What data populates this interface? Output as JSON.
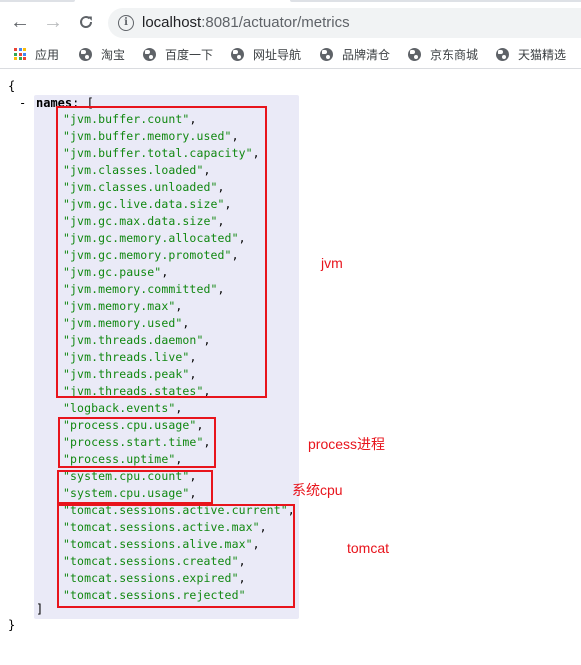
{
  "browser": {
    "url_host": "localhost",
    "url_rest": ":8081/actuator/metrics",
    "nav": {
      "back": "←",
      "forward": "→",
      "reload": "C"
    },
    "info_icon": "i",
    "bookmarks": [
      {
        "label": "应用",
        "icon": "apps-grid-icon"
      },
      {
        "label": "淘宝",
        "icon": "globe-icon"
      },
      {
        "label": "百度一下",
        "icon": "globe-icon"
      },
      {
        "label": "网址导航",
        "icon": "globe-icon"
      },
      {
        "label": "品牌清仓",
        "icon": "globe-icon"
      },
      {
        "label": "京东商城",
        "icon": "globe-icon"
      },
      {
        "label": "天猫精选",
        "icon": "globe-icon"
      }
    ],
    "apps_colors": [
      "#ea4335",
      "#4285f4",
      "#fbbc05",
      "#34a853",
      "#ea4335",
      "#4285f4",
      "#fbbc05",
      "#34a853",
      "#ea4335"
    ]
  },
  "json_view": {
    "open_brace": "{",
    "close_brace": "}",
    "collapse_toggle": "-",
    "key": "names",
    "key_colon": ":",
    "open_bracket": "[",
    "close_bracket": "]",
    "names": [
      "jvm.buffer.count",
      "jvm.buffer.memory.used",
      "jvm.buffer.total.capacity",
      "jvm.classes.loaded",
      "jvm.classes.unloaded",
      "jvm.gc.live.data.size",
      "jvm.gc.max.data.size",
      "jvm.gc.memory.allocated",
      "jvm.gc.memory.promoted",
      "jvm.gc.pause",
      "jvm.memory.committed",
      "jvm.memory.max",
      "jvm.memory.used",
      "jvm.threads.daemon",
      "jvm.threads.live",
      "jvm.threads.peak",
      "jvm.threads.states",
      "logback.events",
      "process.cpu.usage",
      "process.start.time",
      "process.uptime",
      "system.cpu.count",
      "system.cpu.usage",
      "tomcat.sessions.active.current",
      "tomcat.sessions.active.max",
      "tomcat.sessions.alive.max",
      "tomcat.sessions.created",
      "tomcat.sessions.expired",
      "tomcat.sessions.rejected"
    ]
  },
  "annotations": [
    {
      "label": "jvm",
      "color": "#e8141c"
    },
    {
      "label": "process进程",
      "color": "#e8141c"
    },
    {
      "label": "系统cpu",
      "color": "#e8141c"
    },
    {
      "label": "tomcat",
      "color": "#e8141c"
    }
  ]
}
